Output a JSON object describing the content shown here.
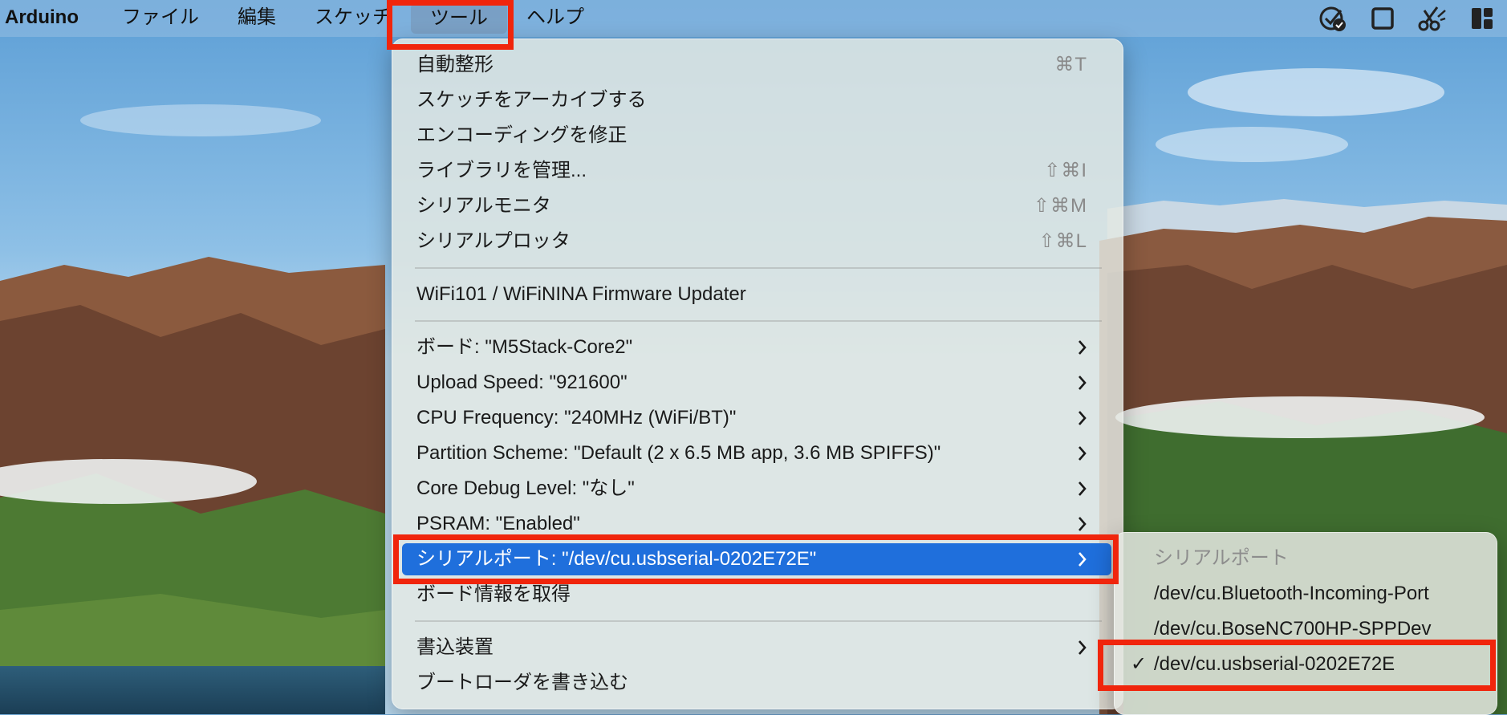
{
  "menubar": {
    "app_name": "Arduino",
    "items": [
      "ファイル",
      "編集",
      "スケッチ",
      "ツール",
      "ヘルプ"
    ],
    "active_item": "ツール",
    "status_icons": [
      "checkmark-badge-icon",
      "square-icon",
      "scissors-icon",
      "layout-panel-icon"
    ]
  },
  "tools_menu": {
    "items": [
      {
        "label": "自動整形",
        "shortcut": "⌘T"
      },
      {
        "label": "スケッチをアーカイブする",
        "shortcut": ""
      },
      {
        "label": "エンコーディングを修正",
        "shortcut": ""
      },
      {
        "label": "ライブラリを管理...",
        "shortcut": "⇧⌘I"
      },
      {
        "label": "シリアルモニタ",
        "shortcut": "⇧⌘M"
      },
      {
        "label": "シリアルプロッタ",
        "shortcut": "⇧⌘L"
      },
      {
        "label": "WiFi101 / WiFiNINA Firmware Updater",
        "shortcut": ""
      },
      {
        "label": "ボード: \"M5Stack-Core2\"",
        "submenu": true
      },
      {
        "label": "Upload Speed: \"921600\"",
        "submenu": true
      },
      {
        "label": "CPU Frequency: \"240MHz (WiFi/BT)\"",
        "submenu": true
      },
      {
        "label": "Partition Scheme: \"Default (2 x 6.5 MB app, 3.6 MB SPIFFS)\"",
        "submenu": true
      },
      {
        "label": "Core Debug Level: \"なし\"",
        "submenu": true
      },
      {
        "label": "PSRAM: \"Enabled\"",
        "submenu": true
      },
      {
        "label": "シリアルポート: \"/dev/cu.usbserial-0202E72E\"",
        "submenu": true,
        "selected": true
      },
      {
        "label": "ボード情報を取得",
        "shortcut": ""
      },
      {
        "label": "書込装置",
        "submenu": true
      },
      {
        "label": "ブートローダを書き込む",
        "shortcut": ""
      }
    ],
    "chevron": "›"
  },
  "port_submenu": {
    "header": "シリアルポート",
    "items": [
      {
        "label": "/dev/cu.Bluetooth-Incoming-Port",
        "checked": false
      },
      {
        "label": "/dev/cu.BoseNC700HP-SPPDev",
        "checked": false
      },
      {
        "label": "/dev/cu.usbserial-0202E72E",
        "checked": true
      }
    ],
    "check_mark": "✓"
  },
  "colors": {
    "selection": "#1f6fdc",
    "highlight_box": "#f0250c"
  }
}
